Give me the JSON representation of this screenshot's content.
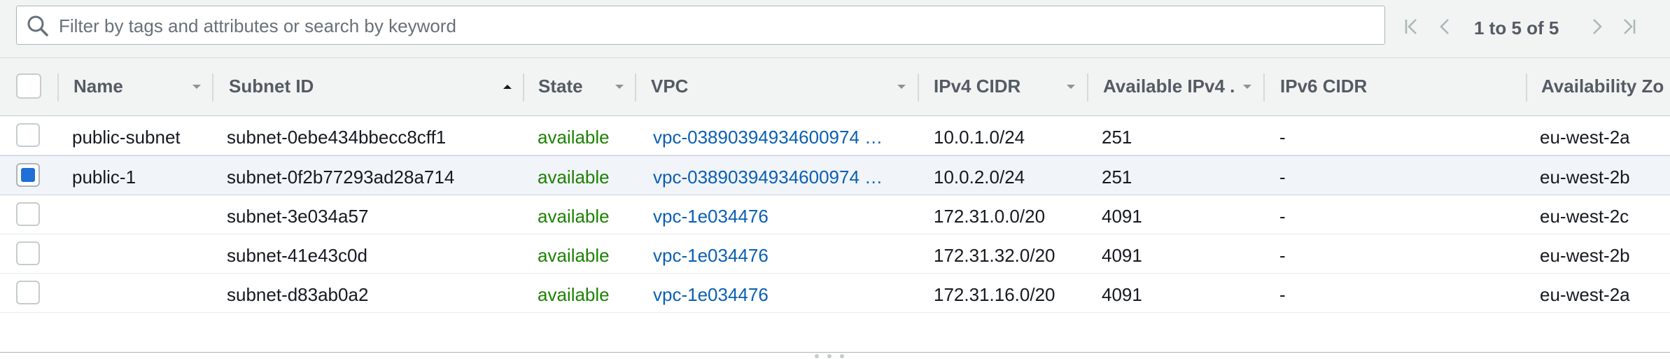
{
  "filter": {
    "placeholder": "Filter by tags and attributes or search by keyword",
    "icon": "search-icon"
  },
  "pagination": {
    "text": "1 to 5 of 5",
    "first_icon": "first-page-icon",
    "prev_icon": "previous-page-icon",
    "next_icon": "next-page-icon",
    "last_icon": "last-page-icon"
  },
  "table": {
    "columns": [
      {
        "key": "name",
        "label": "Name",
        "sort": "caret-down"
      },
      {
        "key": "subnet_id",
        "label": "Subnet ID",
        "sort": "caret-up"
      },
      {
        "key": "state",
        "label": "State",
        "sort": "caret-down"
      },
      {
        "key": "vpc",
        "label": "VPC",
        "sort": "caret-down"
      },
      {
        "key": "ipv4_cidr",
        "label": "IPv4 CIDR",
        "sort": "caret-down"
      },
      {
        "key": "available_ipv4",
        "label": "Available IPv4 .",
        "sort": "caret-down"
      },
      {
        "key": "ipv6_cidr",
        "label": "IPv6 CIDR",
        "sort": ""
      },
      {
        "key": "availability_zone",
        "label": "Availability Zo",
        "sort": ""
      }
    ],
    "rows": [
      {
        "selected": false,
        "name": "public-subnet",
        "subnet_id": "subnet-0ebe434bbecc8cff1",
        "state": "available",
        "vpc": "vpc-03890394934600974 …",
        "ipv4_cidr": "10.0.1.0/24",
        "available_ipv4": "251",
        "ipv6_cidr": "-",
        "availability_zone": "eu-west-2a"
      },
      {
        "selected": true,
        "name": "public-1",
        "subnet_id": "subnet-0f2b77293ad28a714",
        "state": "available",
        "vpc": "vpc-03890394934600974 …",
        "ipv4_cidr": "10.0.2.0/24",
        "available_ipv4": "251",
        "ipv6_cidr": "-",
        "availability_zone": "eu-west-2b"
      },
      {
        "selected": false,
        "name": "",
        "subnet_id": "subnet-3e034a57",
        "state": "available",
        "vpc": "vpc-1e034476",
        "ipv4_cidr": "172.31.0.0/20",
        "available_ipv4": "4091",
        "ipv6_cidr": "-",
        "availability_zone": "eu-west-2c"
      },
      {
        "selected": false,
        "name": "",
        "subnet_id": "subnet-41e43c0d",
        "state": "available",
        "vpc": "vpc-1e034476",
        "ipv4_cidr": "172.31.32.0/20",
        "available_ipv4": "4091",
        "ipv6_cidr": "-",
        "availability_zone": "eu-west-2b"
      },
      {
        "selected": false,
        "name": "",
        "subnet_id": "subnet-d83ab0a2",
        "state": "available",
        "vpc": "vpc-1e034476",
        "ipv4_cidr": "172.31.16.0/20",
        "available_ipv4": "4091",
        "ipv6_cidr": "-",
        "availability_zone": "eu-west-2a"
      }
    ]
  },
  "colors": {
    "state_available": "#1d8102",
    "link": "#0a5fb4",
    "selected_row": "#f1f4f9",
    "checkbox_checked": "#1f6fd6"
  }
}
